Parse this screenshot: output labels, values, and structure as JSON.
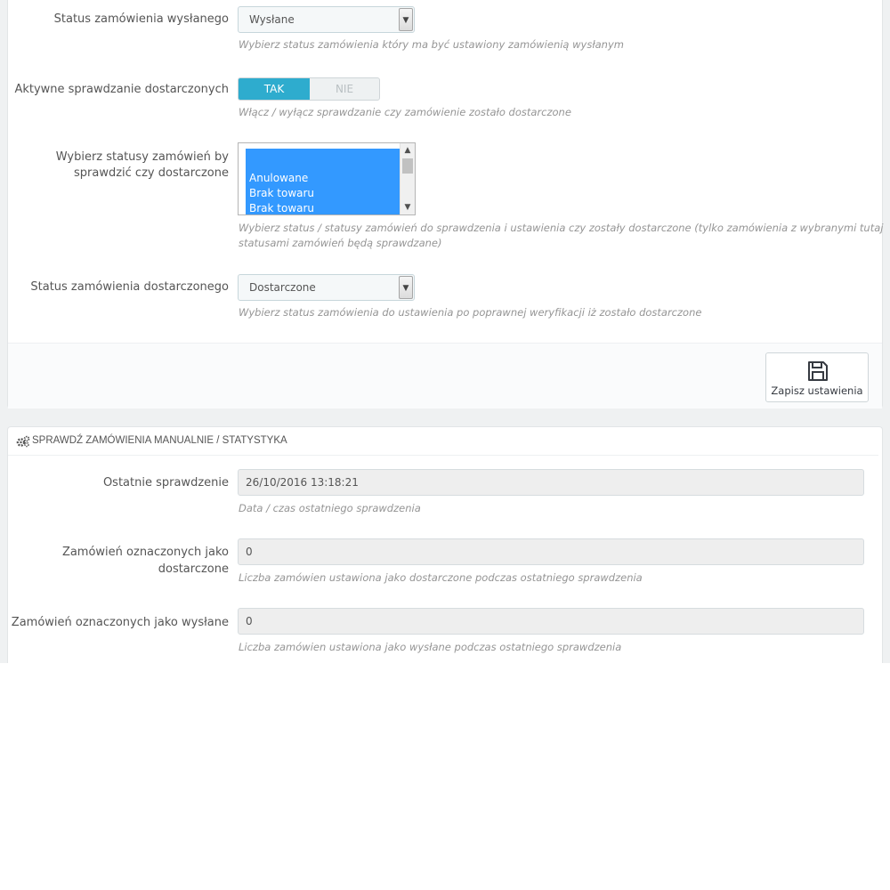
{
  "settings": {
    "sent_status": {
      "label": "Status zamówienia wysłanego",
      "value": "Wysłane",
      "help": "Wybierz status zamówienia który ma być ustawiony zamówienią wysłanym"
    },
    "active_check": {
      "label": "Aktywne sprawdzanie dostarczonych",
      "on_label": "TAK",
      "off_label": "NIE",
      "selected": "TAK",
      "help": "Włącz / wyłącz sprawdzanie czy zamówienie zostało dostarczone"
    },
    "statuses_to_check": {
      "label_line1": "Wybierz statusy zamówień by",
      "label_line2": "sprawdzić czy dostarczone",
      "options": [
        "Anulowane",
        "Brak towaru",
        "Brak towaru"
      ],
      "help_line1": "Wybierz status / statusy zamówień do sprawdzenia i ustawienia czy zostały dostarczone (tylko zamówienia z wybranymi tutaj",
      "help_line2": "statusami zamówień będą sprawdzane)"
    },
    "delivered_status": {
      "label": "Status zamówienia dostarczonego",
      "value": "Dostarczone",
      "help": "Wybierz status zamówienia do ustawienia po poprawnej weryfikacji iż zostało dostarczone"
    },
    "save_label": "Zapisz ustawienia"
  },
  "stats": {
    "heading": "SPRAWDŹ ZAMÓWIENIA MANUALNIE / STATYSTYKA",
    "last_check": {
      "label": "Ostatnie sprawdzenie",
      "value": "26/10/2016 13:18:21",
      "help": "Data / czas ostatniego sprawdzenia"
    },
    "marked_delivered": {
      "label_line1": "Zamówień oznaczonych jako",
      "label_line2": "dostarczone",
      "value": "0",
      "help": "Liczba zamówien ustawiona jako dostarczone podczas ostatniego sprawdzenia"
    },
    "marked_sent": {
      "label": "Zamówień oznaczonych jako wysłane",
      "value": "0",
      "help": "Liczba zamówien ustawiona jako wysłane podczas ostatniego sprawdzenia"
    }
  },
  "icons": {
    "save": "floppy-disk-icon",
    "heading": "gears-icon",
    "select_arrow": "chevron-down-icon"
  },
  "colors": {
    "switch_on": "#2eacce",
    "listbox_selection": "#3399ff",
    "page_background": "#eff1f2"
  }
}
